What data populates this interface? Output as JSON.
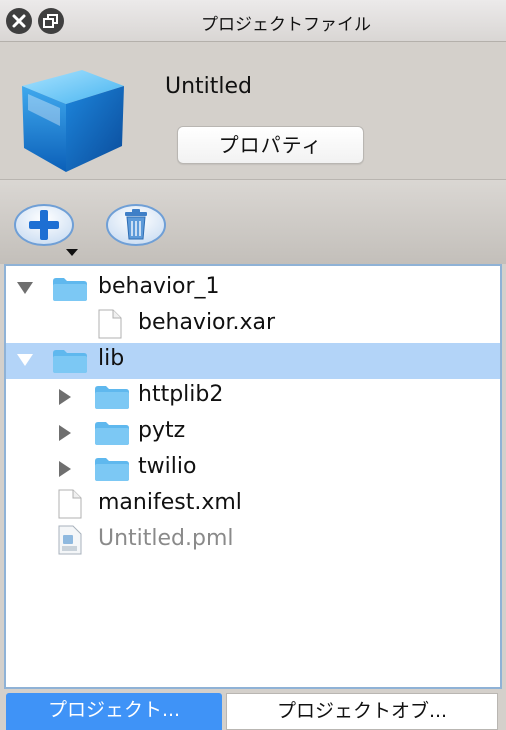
{
  "window": {
    "title": "プロジェクトファイル"
  },
  "header": {
    "project_name": "Untitled",
    "properties_button": "プロパティ"
  },
  "toolbar": {
    "add_icon": "plus-icon",
    "delete_icon": "trash-icon"
  },
  "tree": [
    {
      "label": "behavior_1",
      "type": "folder",
      "expanded": true
    },
    {
      "label": "behavior.xar",
      "type": "file"
    },
    {
      "label": "lib",
      "type": "folder",
      "expanded": true,
      "selected": true
    },
    {
      "label": "httplib2",
      "type": "folder",
      "expanded": false
    },
    {
      "label": "pytz",
      "type": "folder",
      "expanded": false
    },
    {
      "label": "twilio",
      "type": "folder",
      "expanded": false
    },
    {
      "label": "manifest.xml",
      "type": "file"
    },
    {
      "label": "Untitled.pml",
      "type": "pml-file",
      "dimmed": true
    }
  ],
  "tabs": [
    {
      "label": "プロジェクト...",
      "active": true
    },
    {
      "label": "プロジェクトオブ...",
      "active": false
    }
  ],
  "colors": {
    "selection": "#b3d4f8",
    "folder": "#5fb8ee",
    "active_tab": "#3f93f7"
  }
}
